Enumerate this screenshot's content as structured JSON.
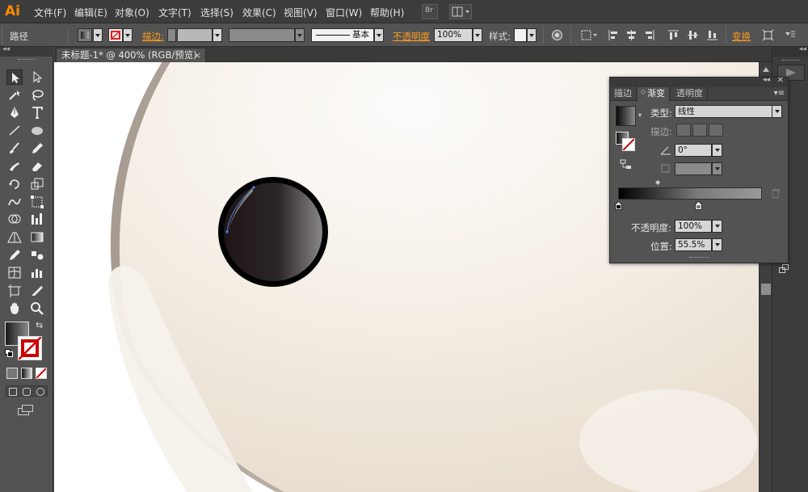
{
  "app": {
    "logo": "Ai"
  },
  "menu": [
    "文件(F)",
    "编辑(E)",
    "对象(O)",
    "文字(T)",
    "选择(S)",
    "效果(C)",
    "视图(V)",
    "窗口(W)",
    "帮助(H)"
  ],
  "menubar_extras": {
    "bridge_label": "Br"
  },
  "control_bar": {
    "selection_type": "路径",
    "stroke_label": "描边:",
    "brush_label": "基本",
    "opacity_label": "不透明度",
    "opacity_value": "100%",
    "style_label": "样式:",
    "transform_label": "变换"
  },
  "document_tab": {
    "title": "未标题-1* @ 400% (RGB/预览)",
    "close": "×"
  },
  "gradient_panel": {
    "tabs": [
      "描边",
      "渐变",
      "透明度"
    ],
    "active_tab": "渐变",
    "type_label": "类型:",
    "type_value": "线性",
    "stroke_label": "描边:",
    "angle_value": "0°",
    "aspect_value": "",
    "opacity_label": "不透明度:",
    "opacity_value": "100%",
    "location_label": "位置:",
    "location_value": "55.5%",
    "gradient_stops": [
      {
        "location": 0,
        "color": "#000000"
      },
      {
        "location": 55.5,
        "color": "#7a7a7a"
      }
    ]
  },
  "colors": {
    "accent_orange": "#ff9a1f",
    "panel_bg": "#535353",
    "egg_fill": "#f5efe6",
    "pupil_outer": "#000000",
    "selection_path": "#4f7fdc"
  },
  "icons": {
    "tools": [
      "selection-tool",
      "direct-selection-tool",
      "magic-wand-tool",
      "lasso-tool",
      "pen-tool",
      "type-tool",
      "line-tool",
      "ellipse-tool",
      "paintbrush-tool",
      "pencil-tool",
      "blob-brush-tool",
      "eraser-tool",
      "rotate-tool",
      "scale-tool",
      "warp-tool",
      "free-transform-tool",
      "shape-builder-tool",
      "symbol-sprayer-tool",
      "perspective-grid-tool",
      "gradient-tool",
      "mesh-tool",
      "blend-tool",
      "eyedropper-tool",
      "column-graph-tool",
      "artboard-tool",
      "slice-tool",
      "hand-tool",
      "zoom-tool"
    ]
  }
}
